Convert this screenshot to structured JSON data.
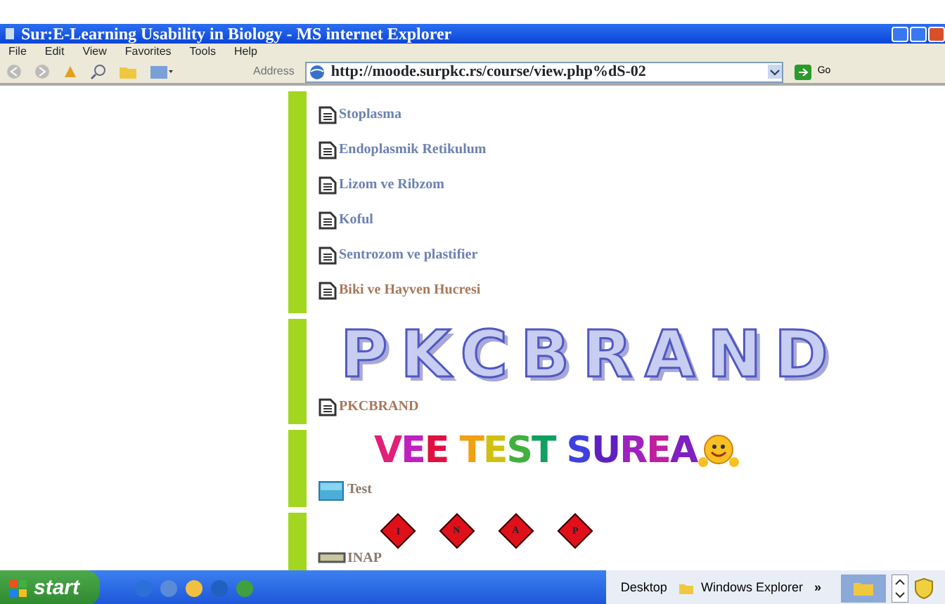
{
  "window": {
    "title": "Sur:E-Learning Usability in Biology - MS internet Explorer"
  },
  "menu": [
    "File",
    "Edit",
    "View",
    "Favorites",
    "Tools",
    "Help"
  ],
  "address_bar": {
    "label": "Address",
    "url": "http://moode.surpkc.rs/course/view.php%dS-02",
    "go": "Go"
  },
  "sections": [
    {
      "items": [
        {
          "kind": "page",
          "label": "Stoplasma",
          "color": "#6d82b0"
        },
        {
          "kind": "page",
          "label": "Endoplasmik Retikulum",
          "color": "#6d82b0"
        },
        {
          "kind": "page",
          "label": "Lizom ve Ribzom",
          "color": "#6d82b0"
        },
        {
          "kind": "page",
          "label": "Koful",
          "color": "#6d82b0"
        },
        {
          "kind": "page",
          "label": "Sentrozom ve plastifier",
          "color": "#6d82b0"
        },
        {
          "kind": "page",
          "label": "Biki ve Hayven Hucresi",
          "color": "#a9785a"
        }
      ]
    },
    {
      "banner": {
        "kind": "outline",
        "text": "PKCBRAND"
      },
      "items": [
        {
          "kind": "page",
          "label": "PKCBRAND",
          "color": "#a9785a"
        }
      ]
    },
    {
      "banner": {
        "kind": "rainbow",
        "text": "VEE TEST SUREA"
      },
      "items": [
        {
          "kind": "quiz",
          "label": "Test",
          "color": "#8a7a6a"
        }
      ]
    },
    {
      "banner": {
        "kind": "diamonds",
        "letters": [
          "I",
          "N",
          "A",
          "P"
        ]
      },
      "items": [
        {
          "kind": "resource",
          "label": "INAP",
          "color": "#8a7a6a"
        }
      ]
    }
  ],
  "taskbar": {
    "start": "start",
    "windows": [
      "Desktop",
      "Windows Explorer"
    ],
    "more": "»"
  }
}
